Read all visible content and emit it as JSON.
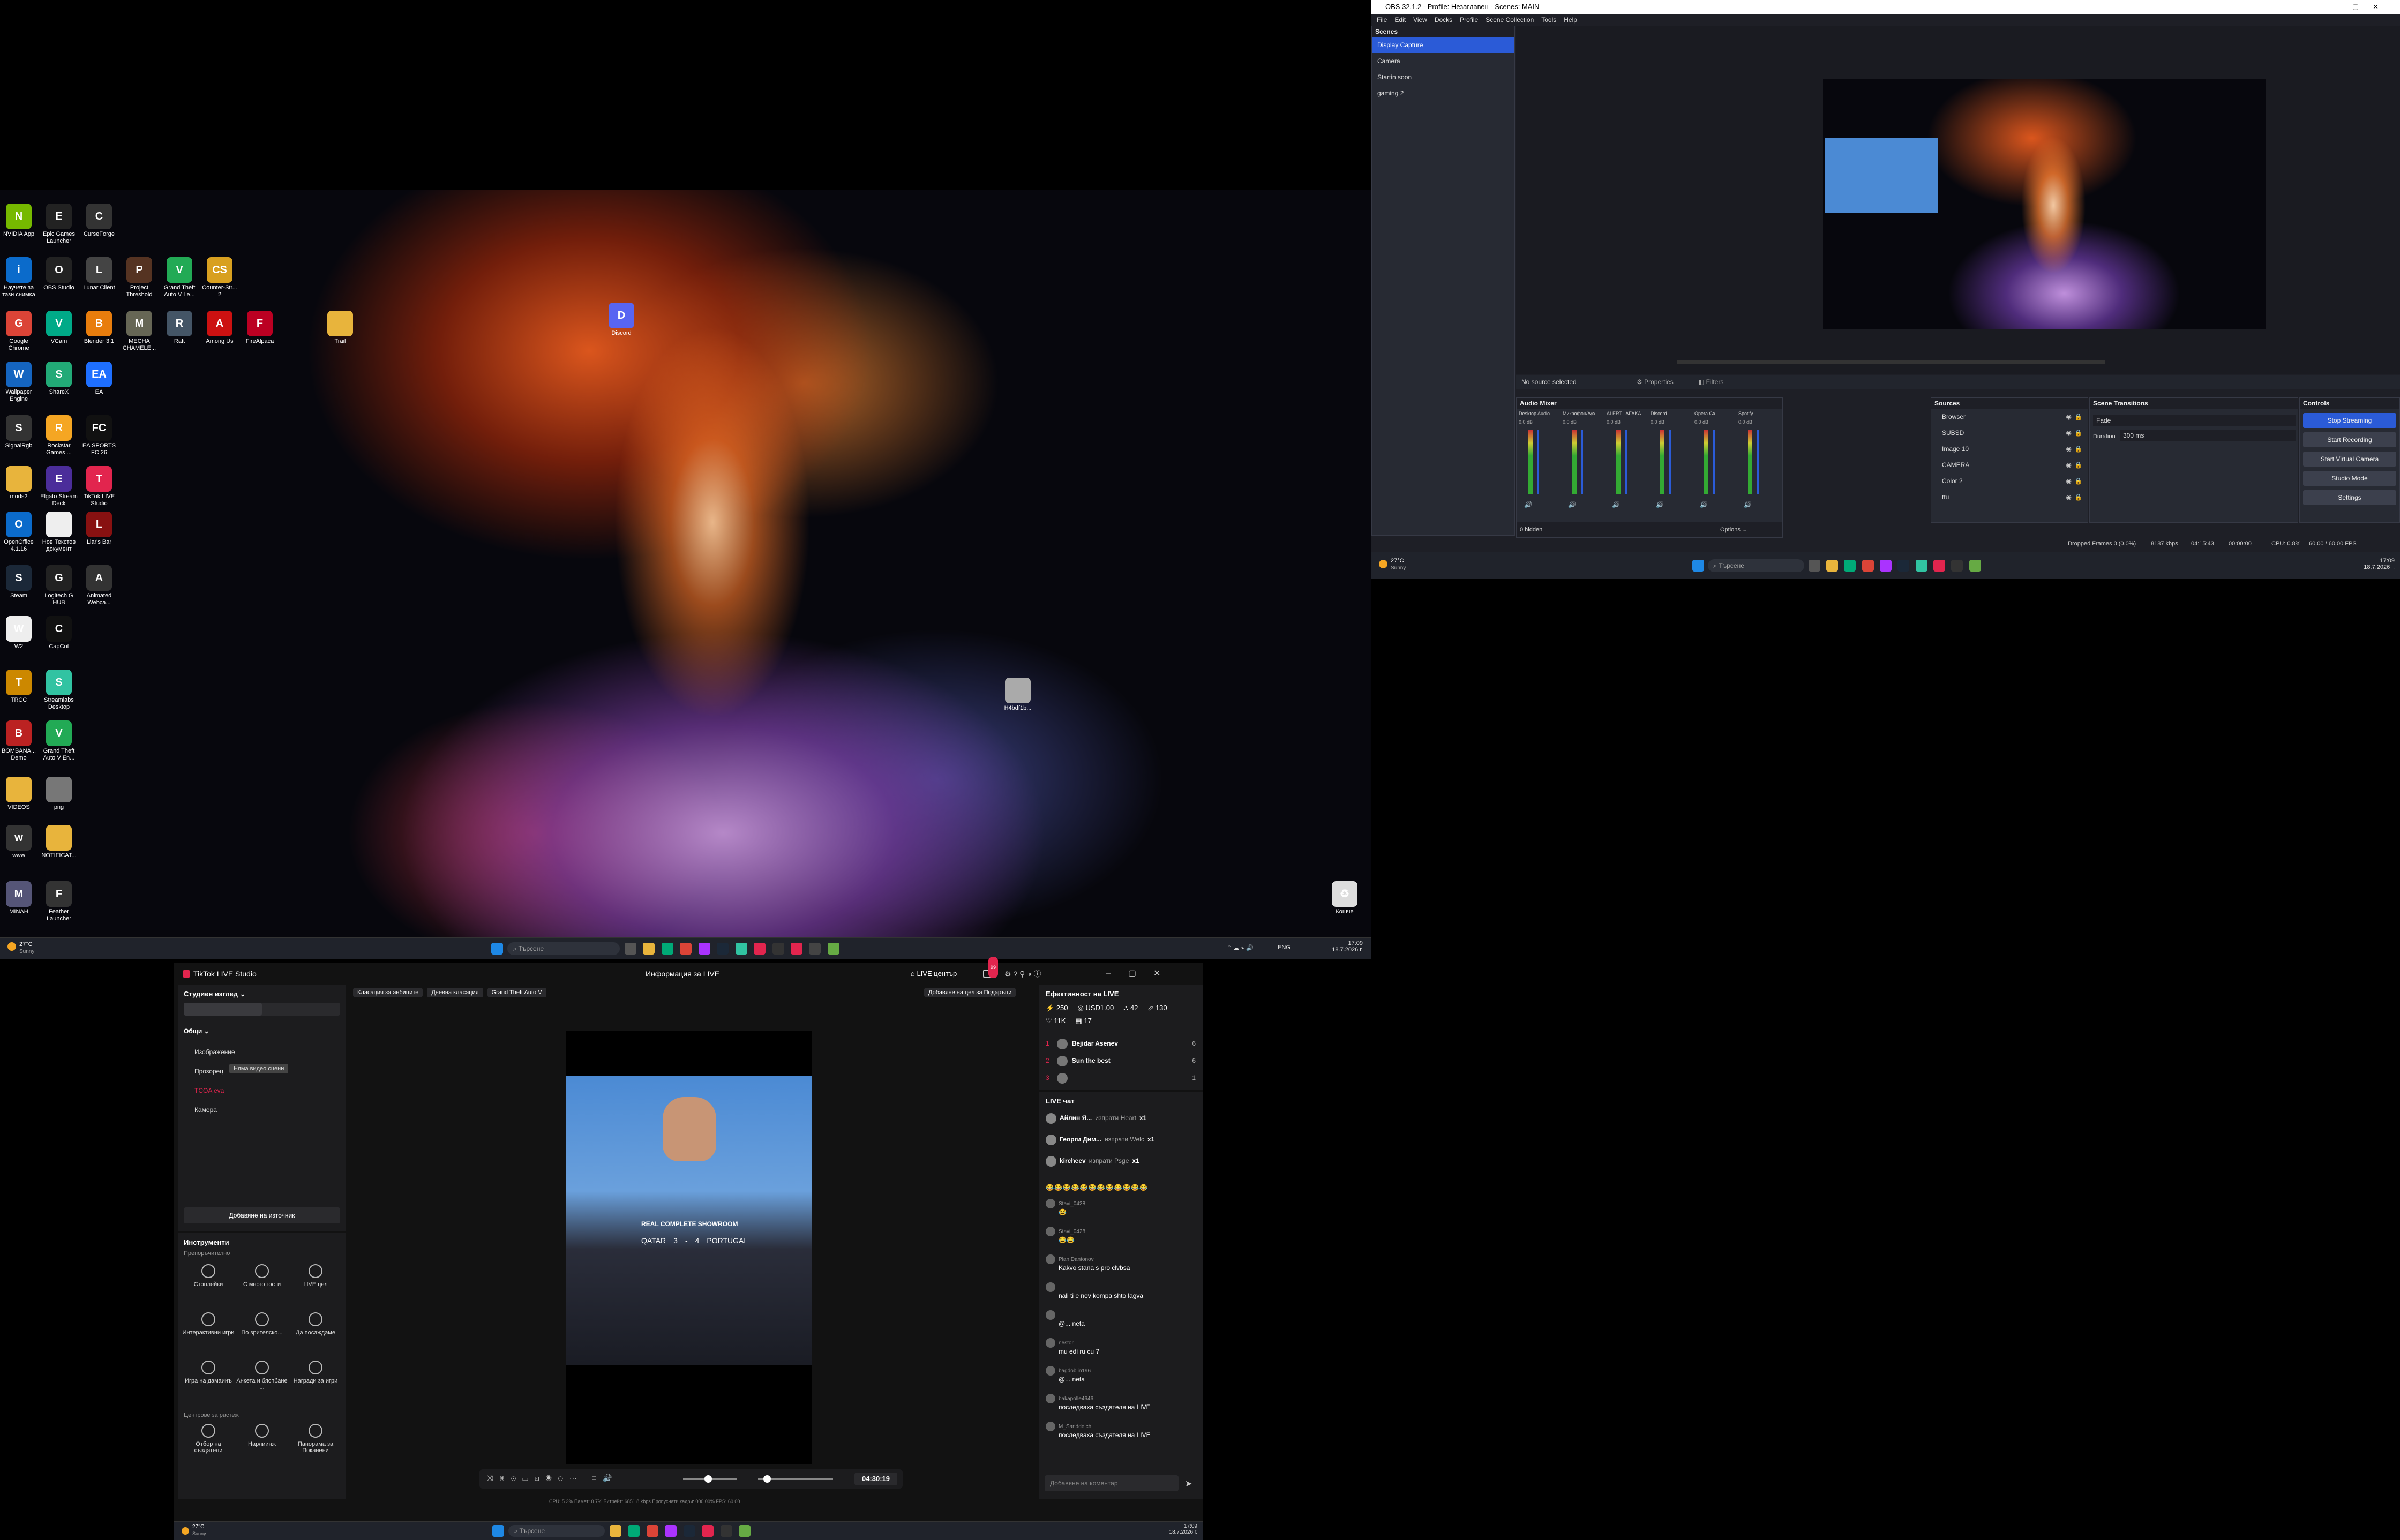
{
  "desktop": {
    "icons": [
      {
        "label": "NVIDIA App",
        "color": "#76b900",
        "glyph": "N"
      },
      {
        "label": "Epic Games Launcher",
        "color": "#222",
        "glyph": "E"
      },
      {
        "label": "CurseForge",
        "color": "#333",
        "glyph": "C"
      },
      {
        "label": "Научете за тази снимка",
        "color": "#0b6bcb",
        "glyph": "i"
      },
      {
        "label": "OBS Studio",
        "color": "#222",
        "glyph": "O"
      },
      {
        "label": "Lunar Client",
        "color": "#444",
        "glyph": "L"
      },
      {
        "label": "Project Threshold",
        "color": "#553322",
        "glyph": "P"
      },
      {
        "label": "Grand Theft Auto V Le...",
        "color": "#2a5",
        "glyph": "V"
      },
      {
        "label": "Counter-Str... 2",
        "color": "#d8a020",
        "glyph": "CS"
      },
      {
        "label": "Google Chrome",
        "color": "#db4437",
        "glyph": "G"
      },
      {
        "label": "VCam",
        "color": "#0a8",
        "glyph": "V"
      },
      {
        "label": "Blender 3.1",
        "color": "#e87d0d",
        "glyph": "B"
      },
      {
        "label": "MECHA CHAMELE...",
        "color": "#665",
        "glyph": "M"
      },
      {
        "label": "Raft",
        "color": "#445566",
        "glyph": "R"
      },
      {
        "label": "Among Us",
        "color": "#c11",
        "glyph": "A"
      },
      {
        "label": "FireAlpaca",
        "color": "#b02",
        "glyph": "F"
      },
      {
        "label": "Trail",
        "color": "#e8b43c",
        "glyph": ""
      },
      {
        "label": "Discord",
        "color": "#5865f2",
        "glyph": "D"
      },
      {
        "label": "Wallpaper Engine",
        "color": "#1565c0",
        "glyph": "W"
      },
      {
        "label": "ShareX",
        "color": "#2a7",
        "glyph": "S"
      },
      {
        "label": "EA",
        "color": "#1e6fff",
        "glyph": "EA"
      },
      {
        "label": "SignalRgb",
        "color": "#333",
        "glyph": "S"
      },
      {
        "label": "Rockstar Games ...",
        "color": "#f5a623",
        "glyph": "R"
      },
      {
        "label": "EA SPORTS FC 26",
        "color": "#111",
        "glyph": "FC"
      },
      {
        "label": "mods2",
        "color": "#e8b43c",
        "glyph": ""
      },
      {
        "label": "Elgato Stream Deck",
        "color": "#4b2d9a",
        "glyph": "E"
      },
      {
        "label": "TikTok LIVE Studio",
        "color": "#e2254e",
        "glyph": "T"
      },
      {
        "label": "OpenOffice 4.1.16",
        "color": "#0b6bcb",
        "glyph": "O"
      },
      {
        "label": "Нов Текстов документ",
        "color": "#eee",
        "glyph": ""
      },
      {
        "label": "Liar's Bar",
        "color": "#811",
        "glyph": "L"
      },
      {
        "label": "Steam",
        "color": "#1b2838",
        "glyph": "S"
      },
      {
        "label": "Logitech G HUB",
        "color": "#222",
        "glyph": "G"
      },
      {
        "label": "Animated Webca...",
        "color": "#333",
        "glyph": "A"
      },
      {
        "label": "W2",
        "color": "#eee",
        "glyph": "W"
      },
      {
        "label": "CapCut",
        "color": "#111",
        "glyph": "C"
      },
      {
        "label": "TRCC",
        "color": "#c80",
        "glyph": "T"
      },
      {
        "label": "Streamlabs Desktop",
        "color": "#31c3a2",
        "glyph": "S"
      },
      {
        "label": "BOMBANA... Demo",
        "color": "#b22",
        "glyph": "B"
      },
      {
        "label": "Grand Theft Auto V En...",
        "color": "#2a5",
        "glyph": "V"
      },
      {
        "label": "VIDEOS",
        "color": "#e8b43c",
        "glyph": ""
      },
      {
        "label": "png",
        "color": "#777",
        "glyph": ""
      },
      {
        "label": "www",
        "color": "#333",
        "glyph": "w"
      },
      {
        "label": "NOTIFICAT...",
        "color": "#e8b43c",
        "glyph": ""
      },
      {
        "label": "MINAH",
        "color": "#557",
        "glyph": "M"
      },
      {
        "label": "Feather Launcher",
        "color": "#333",
        "glyph": "F"
      },
      {
        "label": "Кошче",
        "color": "#ddd",
        "glyph": "♻"
      },
      {
        "label": "H4bdf1b...",
        "color": "#aaa",
        "glyph": ""
      }
    ],
    "taskbar": {
      "weather_temp": "27°C",
      "weather_text": "Sunny",
      "search": "Търсене",
      "lang": "ENG",
      "time": "17:09",
      "date": "18.7.2026 г."
    }
  },
  "obs": {
    "title": "OBS 32.1.2 - Profile: Незаглавен - Scenes: MAIN",
    "menu": [
      "File",
      "Edit",
      "View",
      "Docks",
      "Profile",
      "Scene Collection",
      "Tools",
      "Help"
    ],
    "scenes_title": "Scenes",
    "scenes": [
      "Display Capture",
      "Camera",
      "Startin soon",
      "gaming 2"
    ],
    "no_source": "No source selected",
    "properties": "Properties",
    "filters": "Filters",
    "audio_title": "Audio Mixer",
    "audio_channels": [
      "Desktop Audio",
      "Микрофон/Аух",
      "ALERT...AFAKA",
      "Discord",
      "Opera Gx",
      "Spotify"
    ],
    "audio_db": [
      "0.0 dB",
      "0.0 dB",
      "0.0 dB",
      "0.0 dB",
      "0.0 dB",
      "0.0 dB"
    ],
    "hidden": "0 hidden",
    "options": "Options",
    "sources_title": "Sources",
    "sources": [
      "Browser",
      "SUBSD",
      "Image 10",
      "CAMERA",
      "Color 2",
      "ttu"
    ],
    "transitions_title": "Scene Transitions",
    "transition": "Fade",
    "duration_label": "Duration",
    "duration": "300 ms",
    "controls_title": "Controls",
    "controls": [
      "Stop Streaming",
      "Start Recording",
      "Start Virtual Camera",
      "Studio Mode",
      "Settings"
    ],
    "status": {
      "dropped": "Dropped Frames 0 (0.0%)",
      "kbps": "8187 kbps",
      "live": "04:15:43",
      "rec": "00:00:00",
      "cpu": "CPU: 0.8%",
      "fps": "60.00 / 60.00 FPS"
    },
    "taskbar": {
      "weather_temp": "27°C",
      "weather_text": "Sunny",
      "search": "Търсене",
      "time": "17:09",
      "date": "18.7.2026 г."
    }
  },
  "tiktok": {
    "app_title": "TikTok LIVE Studio",
    "header_center": "Информация за LIVE",
    "live_center": "LIVE център",
    "live_badge": "99",
    "studio_view": "Студиен изглед",
    "general": "Общи",
    "sources": [
      "Изображение",
      "Прозорец",
      "TCOA eva",
      "Камера"
    ],
    "tooltip": "Няма видео сцени",
    "add_source": "Добавяне на източник",
    "tools": "Инструменти",
    "recommended": "Препоръчително",
    "tools_grid": [
      "Стоплейки",
      "С много гости",
      "LIVE цел",
      "Интерактивни игри",
      "По зрителско...",
      "Да посаждаме",
      "Игра на дамаинъ",
      "Анкета и бяспбане ...",
      "Награди за игри"
    ],
    "growth": "Центрове за растеж",
    "growth_grid": [
      "Отбор на създатели",
      "Нарлиинж",
      "Панорама за Поканени"
    ],
    "top_tags": [
      "Класация за анбиците",
      "Дневна класация",
      "Grand Theft Auto V"
    ],
    "add_goal": "Добавяне на цел за Подаръци",
    "video_overlay": {
      "title": "REAL COMPLETE SHOWROOM",
      "team1": "QATAR",
      "score1": "3",
      "score2": "4",
      "team2": "PORTUGAL"
    },
    "timer": "04:30:19",
    "stats_bottom": "CPU: 5.3%   Памет: 0.7%   Битрейт: 6851.8 kbps   Пропуснати кадри: 000.00%   FPS: 60.00",
    "efficiency_title": "Ефективност на LIVE",
    "stats": {
      "viewers": "250",
      "usd": "USD1.00",
      "likes_users": "42",
      "shares": "130",
      "likes": "11K",
      "gifts": "17"
    },
    "ranking": [
      {
        "rank": "1",
        "name": "Bejidar Asenev",
        "score": "6"
      },
      {
        "rank": "2",
        "name": "Sun the best",
        "score": "6"
      },
      {
        "rank": "3",
        "name": "",
        "score": "1"
      }
    ],
    "chat_title": "LIVE чат",
    "gifts": [
      {
        "name": "Айлин Я...",
        "text": "изпрати Heart",
        "count": "x1"
      },
      {
        "name": "Георги Дим...",
        "text": "изпрати Welc",
        "count": "x1"
      },
      {
        "name": "kircheev",
        "text": "изпрати Psge",
        "count": "x1"
      }
    ],
    "chat": [
      {
        "user": "Stavi_0428",
        "text": "😂"
      },
      {
        "user": "Stavi_0428",
        "text": "😂😂"
      },
      {
        "user": "Plan Dantonov",
        "text": "Kakvo stana s pro clvbsa"
      },
      {
        "user": "",
        "text": "nali ti e nov kompa shto lagva"
      },
      {
        "user": "",
        "text": "@... neta"
      },
      {
        "user": "nestor",
        "text": "mu edi ru cu ?"
      },
      {
        "user": "bagdoblin196",
        "text": "@... neta"
      },
      {
        "user": "bakapolle4646",
        "text": "последваха създателя на LIVE"
      },
      {
        "user": "M_Sanddelch",
        "text": "последваха създателя на LIVE"
      }
    ],
    "emoji_row": "😂😂😂😂😂😂😂😂😂😂😂😂",
    "comment_placeholder": "Добавяне на коментар",
    "taskbar": {
      "weather_temp": "27°C",
      "weather_text": "Sunny",
      "search": "Търсене",
      "time": "17:09",
      "date": "18.7.2026 г."
    }
  }
}
